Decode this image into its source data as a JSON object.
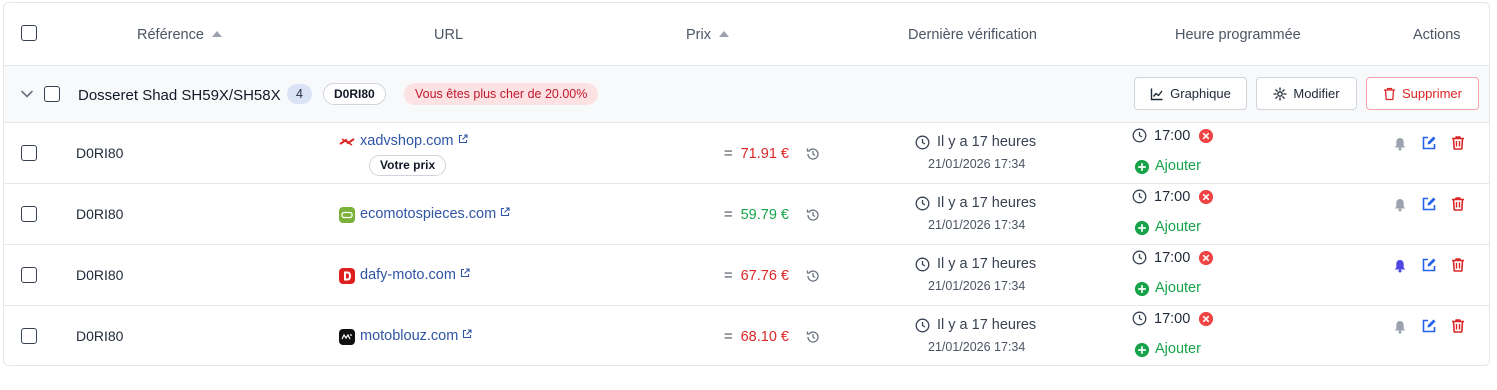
{
  "table": {
    "headers": {
      "reference": "Référence",
      "url": "URL",
      "price": "Prix",
      "last_check": "Dernière vérification",
      "scheduled": "Heure programmée",
      "actions": "Actions"
    }
  },
  "group": {
    "title": "Dosseret Shad SH59X/SH58X",
    "count": "4",
    "ref": "D0RI80",
    "warning": "Vous êtes plus cher de 20.00%",
    "buttons": {
      "chart": "Graphique",
      "edit": "Modifier",
      "delete": "Supprimer"
    }
  },
  "rows": [
    {
      "ref": "D0RI80",
      "site": "xadvshop.com",
      "site_icon": "xadv-logo",
      "your_price": "Votre prix",
      "price": "71.91 €",
      "price_status": "higher",
      "last_check_ago": "Il y a 17 heures",
      "last_check_date": "21/01/2026 17:34",
      "scheduled_time": "17:00",
      "add_label": "Ajouter",
      "bell_active": false
    },
    {
      "ref": "D0RI80",
      "site": "ecomotospieces.com",
      "site_icon": "ecomoto-logo",
      "price": "59.79 €",
      "price_status": "lower",
      "last_check_ago": "Il y a 17 heures",
      "last_check_date": "21/01/2026 17:34",
      "scheduled_time": "17:00",
      "add_label": "Ajouter",
      "bell_active": false
    },
    {
      "ref": "D0RI80",
      "site": "dafy-moto.com",
      "site_icon": "dafy-logo",
      "price": "67.76 €",
      "price_status": "higher",
      "last_check_ago": "Il y a 17 heures",
      "last_check_date": "21/01/2026 17:34",
      "scheduled_time": "17:00",
      "add_label": "Ajouter",
      "bell_active": true
    },
    {
      "ref": "D0RI80",
      "site": "motoblouz.com",
      "site_icon": "motoblouz-logo",
      "price": "68.10 €",
      "price_status": "higher",
      "last_check_ago": "Il y a 17 heures",
      "last_check_date": "21/01/2026 17:34",
      "scheduled_time": "17:00",
      "add_label": "Ajouter",
      "bell_active": false
    }
  ],
  "colors": {
    "higher": "#dc2626",
    "lower": "#16a34a",
    "link": "#2f55a4",
    "bell_active": "#4f46e5",
    "bell_inactive": "#9ca3af"
  }
}
